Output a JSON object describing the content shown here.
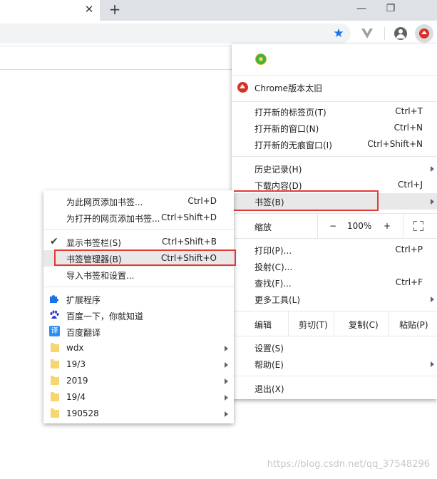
{
  "browser": {
    "tab_close_glyph": "✕",
    "new_tab_glyph": "+",
    "window_controls": {
      "minimize": "—",
      "restore": "❐"
    }
  },
  "menu": {
    "update_item": "Chrome版本太旧",
    "items_group1": [
      {
        "label": "打开新的标签页(T)",
        "shortcut": "Ctrl+T"
      },
      {
        "label": "打开新的窗口(N)",
        "shortcut": "Ctrl+N"
      },
      {
        "label": "打开新的无痕窗口(I)",
        "shortcut": "Ctrl+Shift+N"
      }
    ],
    "items_group2": [
      {
        "label": "历史记录(H)",
        "shortcut": ""
      },
      {
        "label": "下载内容(D)",
        "shortcut": "Ctrl+J"
      },
      {
        "label": "书签(B)",
        "shortcut": ""
      }
    ],
    "zoom": {
      "label": "缩放",
      "minus": "−",
      "value": "100%",
      "plus": "+"
    },
    "items_group3": [
      {
        "label": "打印(P)...",
        "shortcut": "Ctrl+P"
      },
      {
        "label": "投射(C)...",
        "shortcut": ""
      },
      {
        "label": "查找(F)...",
        "shortcut": "Ctrl+F"
      },
      {
        "label": "更多工具(L)",
        "shortcut": ""
      }
    ],
    "edit": {
      "label": "编辑",
      "cut": "剪切(T)",
      "copy": "复制(C)",
      "paste": "粘贴(P)"
    },
    "items_group4": [
      {
        "label": "设置(S)"
      },
      {
        "label": "帮助(E)"
      }
    ],
    "exit": "退出(X)"
  },
  "bookmarks_submenu": {
    "add_page": {
      "label": "为此网页添加书签...",
      "shortcut": "Ctrl+D"
    },
    "add_open": {
      "label": "为打开的网页添加书签...",
      "shortcut": "Ctrl+Shift+D"
    },
    "show_bar": {
      "label": "显示书签栏(S)",
      "shortcut": "Ctrl+Shift+B"
    },
    "manager": {
      "label": "书签管理器(B)",
      "shortcut": "Ctrl+Shift+O"
    },
    "import": {
      "label": "导入书签和设置..."
    },
    "extensions": "扩展程序",
    "baidu": "百度一下，你就知道",
    "translate_icon_text": "译",
    "translate": "百度翻译",
    "folders": [
      "wdx",
      "19/3",
      "2019",
      "19/4",
      "190528"
    ]
  },
  "watermark": "https://blog.csdn.net/qq_37548296",
  "colors": {
    "highlight_box": "#e53935",
    "accent_blue": "#1a73e8",
    "update_red": "#d93025"
  }
}
